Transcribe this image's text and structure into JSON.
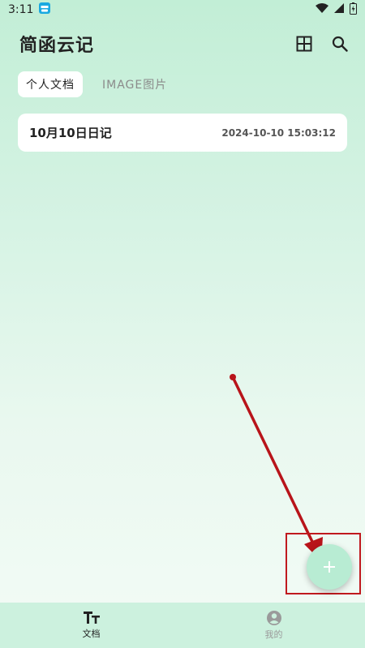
{
  "status_bar": {
    "time": "3:11",
    "icons": [
      "app-notification-icon",
      "wifi-icon",
      "signal-icon",
      "battery-icon"
    ]
  },
  "header": {
    "title": "简函云记",
    "actions": [
      "grid-view-icon",
      "search-icon"
    ]
  },
  "tabs": [
    {
      "label": "个人文档",
      "active": true
    },
    {
      "label": "IMAGE图片",
      "active": false
    }
  ],
  "documents": [
    {
      "title": "10月10日日记",
      "time": "2024-10-10 15:03:12"
    }
  ],
  "fab": {
    "icon": "plus-icon",
    "symbol": "+"
  },
  "bottom_nav": [
    {
      "label": "文档",
      "icon": "text-format-icon",
      "active": true
    },
    {
      "label": "我的",
      "icon": "user-profile-icon",
      "active": false
    }
  ],
  "colors": {
    "accent": "#b8ecd3",
    "annotation_red": "#c0191e",
    "nav_bg": "#ccf1de"
  }
}
